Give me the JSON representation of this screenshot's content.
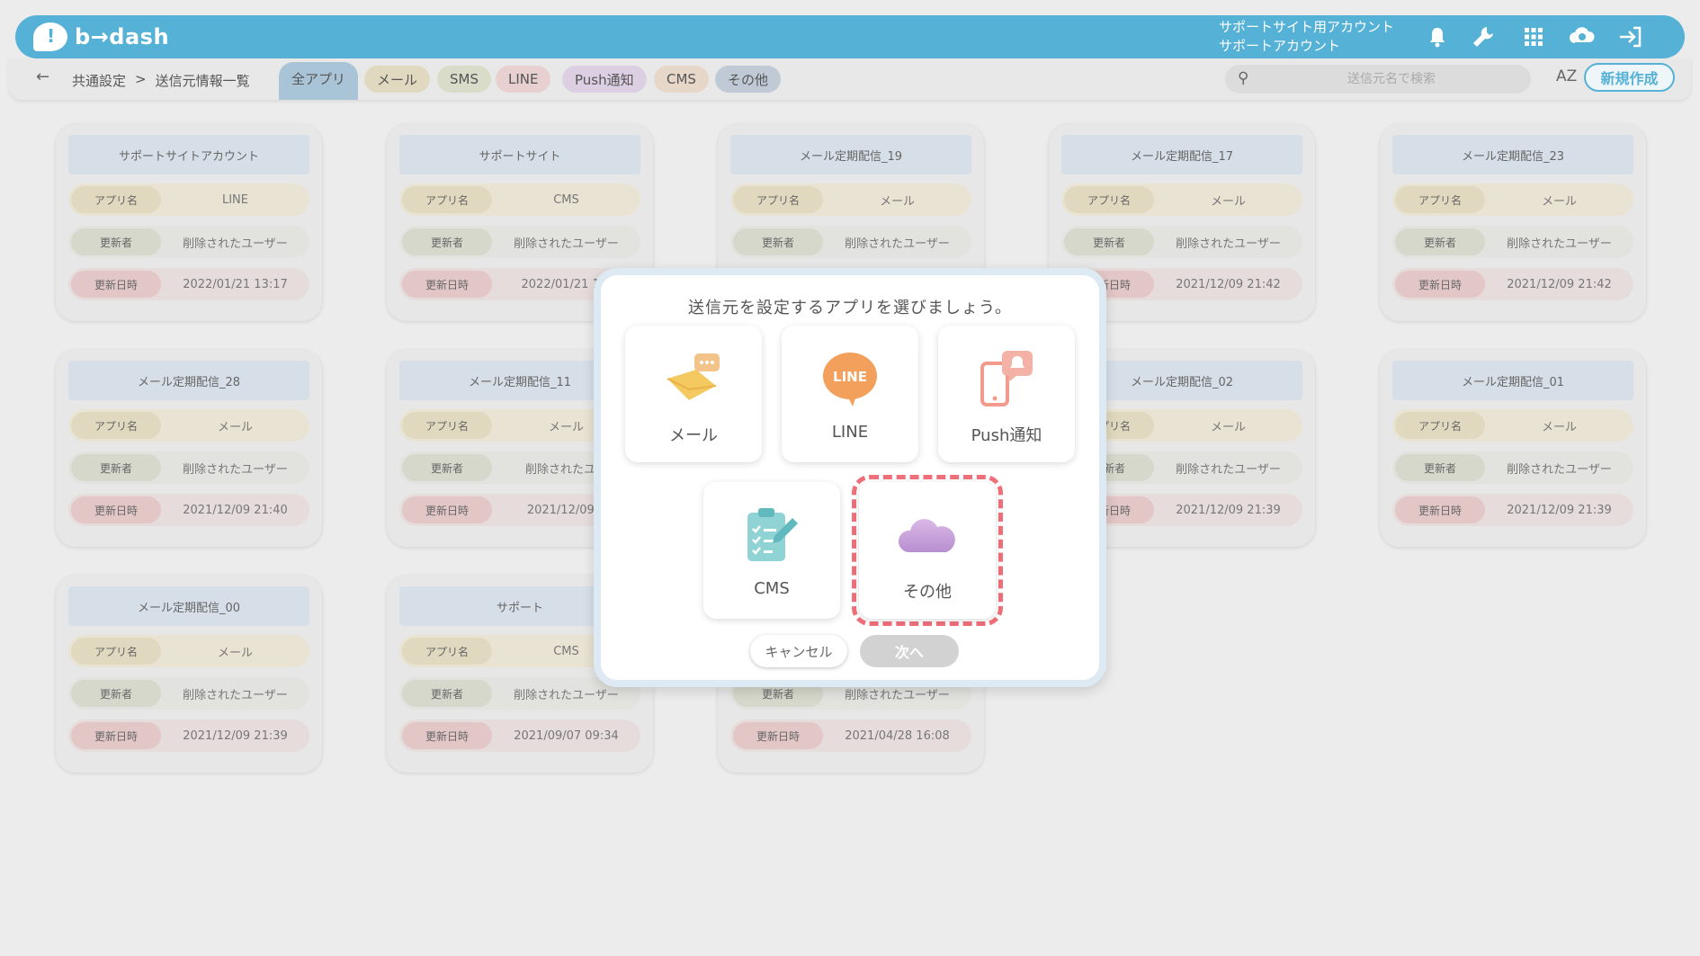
{
  "header": {
    "logo_text": "b→dash",
    "account_line1": "サポートサイト用アカウント",
    "account_line2": "サポートアカウント",
    "icons": [
      "bell-icon",
      "wrench-icon",
      "grid-icon",
      "cloud-badge-icon",
      "logout-icon"
    ]
  },
  "toolbar": {
    "back_icon": "←",
    "breadcrumb": [
      "共通設定",
      ">",
      "送信元情報一覧"
    ],
    "filters": [
      {
        "label": "全アプリ",
        "color": "#a9c4d6",
        "active": true
      },
      {
        "label": "メール",
        "color": "#e1d9bf"
      },
      {
        "label": "SMS",
        "color": "#d8dcc8"
      },
      {
        "label": "LINE",
        "color": "#e8cfd0"
      },
      {
        "label": "Push通知",
        "color": "#dccfe3"
      },
      {
        "label": "CMS",
        "color": "#e6d7c8"
      },
      {
        "label": "その他",
        "color": "#bfcad6"
      }
    ],
    "search_placeholder": "送信元名で検索",
    "sort_label": "AZ",
    "new_button": "新規作成"
  },
  "labels": {
    "app": "アプリ名",
    "updater": "更新者",
    "updated": "更新日時"
  },
  "cards": [
    {
      "title": "サポートサイトアカウント",
      "app": "LINE",
      "updater": "削除されたユーザー",
      "date": "2022/01/21 13:17"
    },
    {
      "title": "サポートサイト",
      "app": "CMS",
      "updater": "削除されたユーザー",
      "date": "2022/01/21 13:"
    },
    {
      "title": "メール定期配信_19",
      "app": "メール",
      "updater": "削除されたユーザー",
      "date": ""
    },
    {
      "title": "メール定期配信_17",
      "app": "メール",
      "updater": "削除されたユーザー",
      "date": "2021/12/09 21:42"
    },
    {
      "title": "メール定期配信_23",
      "app": "メール",
      "updater": "削除されたユーザー",
      "date": "2021/12/09 21:42"
    },
    {
      "title": "メール定期配信_28",
      "app": "メール",
      "updater": "削除されたユーザー",
      "date": "2021/12/09 21:40"
    },
    {
      "title": "メール定期配信_11",
      "app": "メール",
      "updater": "削除されたユー",
      "date": "2021/12/09 2"
    },
    {
      "title": "メール定期配信_02",
      "app": "メール",
      "updater": "削除されたユーザー",
      "date": "2021/12/09 21:39"
    },
    {
      "title": "メール定期配信_01",
      "app": "メール",
      "updater": "削除されたユーザー",
      "date": "2021/12/09 21:39"
    },
    {
      "title": "メール定期配信_00",
      "app": "メール",
      "updater": "削除されたユーザー",
      "date": "2021/12/09 21:39"
    },
    {
      "title": "サポート",
      "app": "CMS",
      "updater": "削除されたユーザー",
      "date": "2021/09/07 09:34"
    },
    {
      "title": "",
      "app": "",
      "updater": "削除されたユーザー",
      "date": "2021/04/28 16:08"
    }
  ],
  "modal": {
    "title": "送信元を設定するアプリを選びましょう。",
    "options": [
      {
        "label": "メール",
        "icon": "mail-icon"
      },
      {
        "label": "LINE",
        "icon": "line-icon"
      },
      {
        "label": "Push通知",
        "icon": "push-notification-icon"
      },
      {
        "label": "CMS",
        "icon": "cms-clipboard-icon"
      },
      {
        "label": "その他",
        "icon": "cloud-icon",
        "selected": true
      }
    ],
    "line_icon_text": "LINE",
    "cancel": "キャンセル",
    "next": "次へ"
  }
}
